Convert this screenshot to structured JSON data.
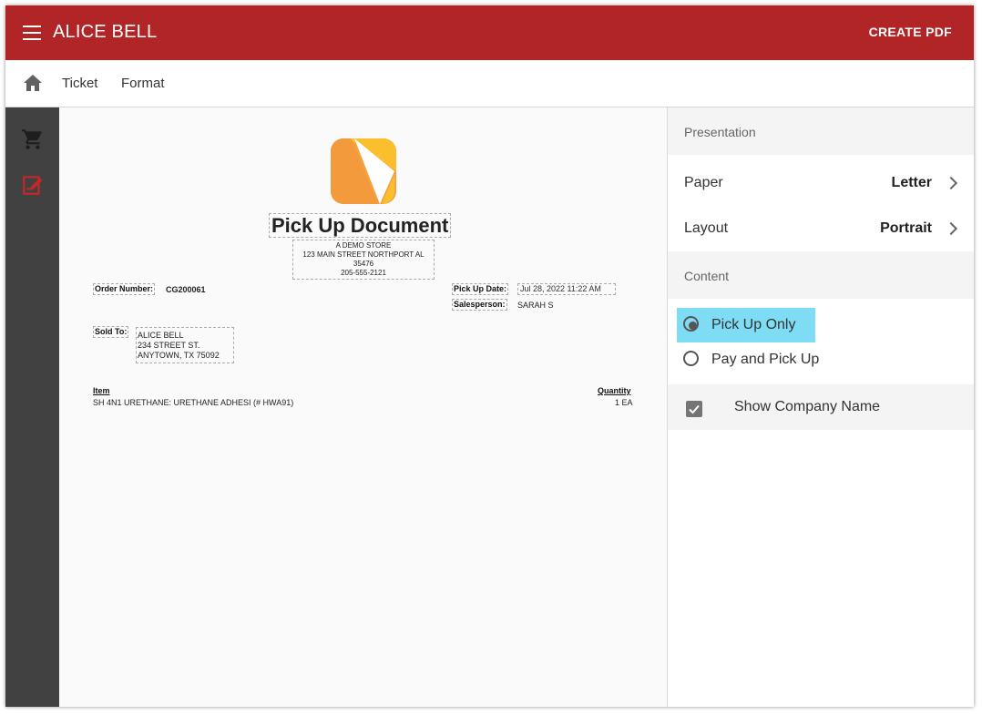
{
  "appbar": {
    "title": "ALICE BELL",
    "create_pdf_label": "CREATE PDF",
    "color": "#b22527"
  },
  "tabs": [
    {
      "label": "Ticket"
    },
    {
      "label": "Format"
    }
  ],
  "sidenav": {
    "items": [
      {
        "icon": "cart-icon",
        "color": "#1e1e1e"
      },
      {
        "icon": "edit-document-icon",
        "color": "#c62828",
        "active": true
      }
    ]
  },
  "document": {
    "title": "Pick Up Document",
    "store": {
      "name": "A DEMO STORE",
      "address": "123 MAIN STREET NORTHPORT AL 35476",
      "phone": "205-555-2121"
    },
    "order_number_label": "Order Number:",
    "order_number": "CG200061",
    "pickup_date_label": "Pick Up Date:",
    "pickup_date": "Jul 28, 2022 11:22 AM",
    "salesperson_label": "Salesperson:",
    "salesperson": "SARAH S",
    "sold_to_label": "Sold To:",
    "sold_to": {
      "name": "ALICE BELL",
      "street": "234 STREET ST.",
      "city": "ANYTOWN, TX 75092"
    },
    "item_header": "Item",
    "quantity_header": "Quantity",
    "items": [
      {
        "item": "SH 4N1 URETHANE: URETHANE ADHESI (# HWA91)",
        "quantity": "1 EA"
      }
    ]
  },
  "panel": {
    "presentation_label": "Presentation",
    "paper_label": "Paper",
    "paper_value": "Letter",
    "layout_label": "Layout",
    "layout_value": "Portrait",
    "content_label": "Content",
    "content_options": [
      {
        "label": "Pick Up Only",
        "selected": true,
        "highlight": "#7fdcf5"
      },
      {
        "label": "Pay and Pick Up",
        "selected": false
      }
    ],
    "show_company_label": "Show Company Name",
    "show_company_checked": true
  }
}
